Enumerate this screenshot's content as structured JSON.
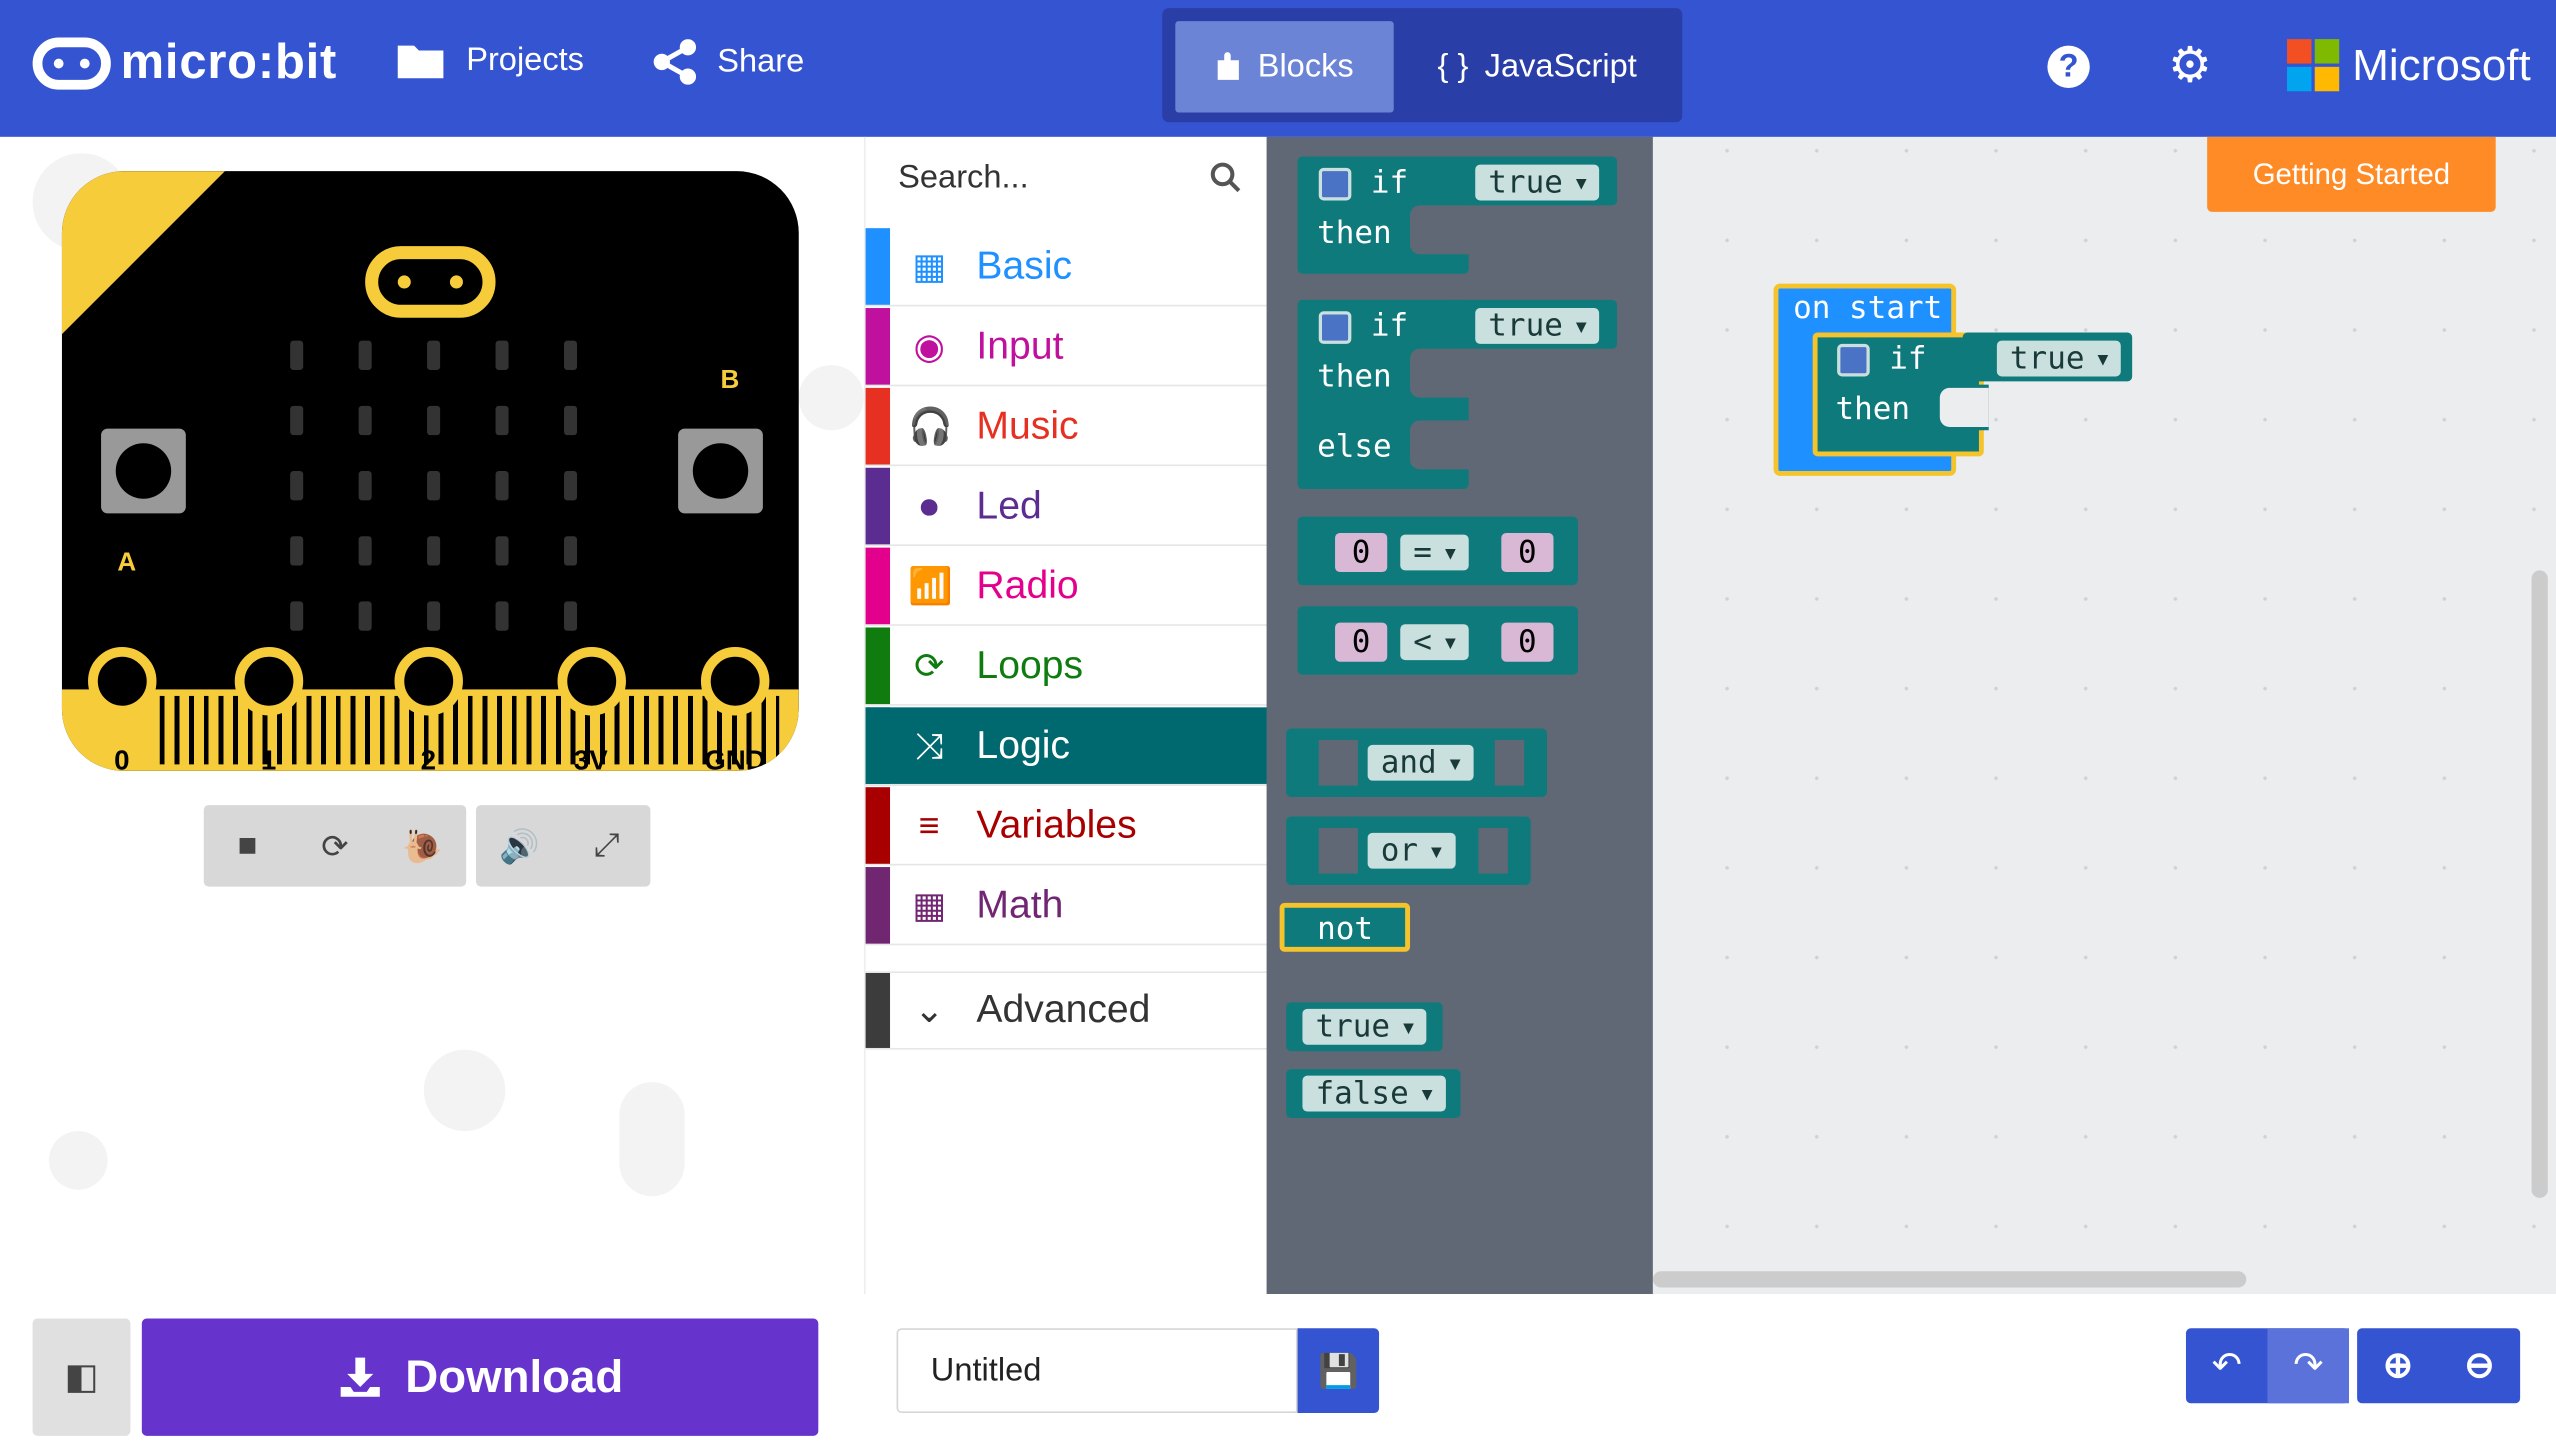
{
  "header": {
    "logo_text": "micro:bit",
    "projects_label": "Projects",
    "share_label": "Share",
    "blocks_label": "Blocks",
    "javascript_label": "JavaScript",
    "microsoft_label": "Microsoft"
  },
  "simulator": {
    "pins": [
      "0",
      "1",
      "2",
      "3V",
      "GND"
    ],
    "button_a": "A",
    "button_b": "B"
  },
  "toolbox": {
    "search_placeholder": "Search...",
    "categories": [
      {
        "label": "Basic",
        "color": "#1e90ff",
        "icon": "grid-icon"
      },
      {
        "label": "Input",
        "color": "#c0109e",
        "icon": "target-icon"
      },
      {
        "label": "Music",
        "color": "#e63022",
        "icon": "headphones-icon"
      },
      {
        "label": "Led",
        "color": "#5c2d91",
        "icon": "toggle-icon"
      },
      {
        "label": "Radio",
        "color": "#e3008c",
        "icon": "signal-icon"
      },
      {
        "label": "Loops",
        "color": "#107c10",
        "icon": "refresh-icon"
      },
      {
        "label": "Logic",
        "color": "#006970",
        "icon": "shuffle-icon"
      },
      {
        "label": "Variables",
        "color": "#a80000",
        "icon": "list-icon"
      },
      {
        "label": "Math",
        "color": "#712672",
        "icon": "calculator-icon"
      }
    ],
    "advanced_label": "Advanced"
  },
  "flyout": {
    "if_kw": "if",
    "then_kw": "then",
    "else_kw": "else",
    "true_val": "true",
    "false_val": "false",
    "zero": "0",
    "eq_op": "=",
    "lt_op": "<",
    "and_op": "and",
    "or_op": "or",
    "not_op": "not"
  },
  "workspace": {
    "getting_started": "Getting Started",
    "on_start": "on start",
    "if_kw": "if",
    "then_kw": "then",
    "true_val": "true"
  },
  "bottom": {
    "download_label": "Download",
    "project_name": "Untitled"
  }
}
